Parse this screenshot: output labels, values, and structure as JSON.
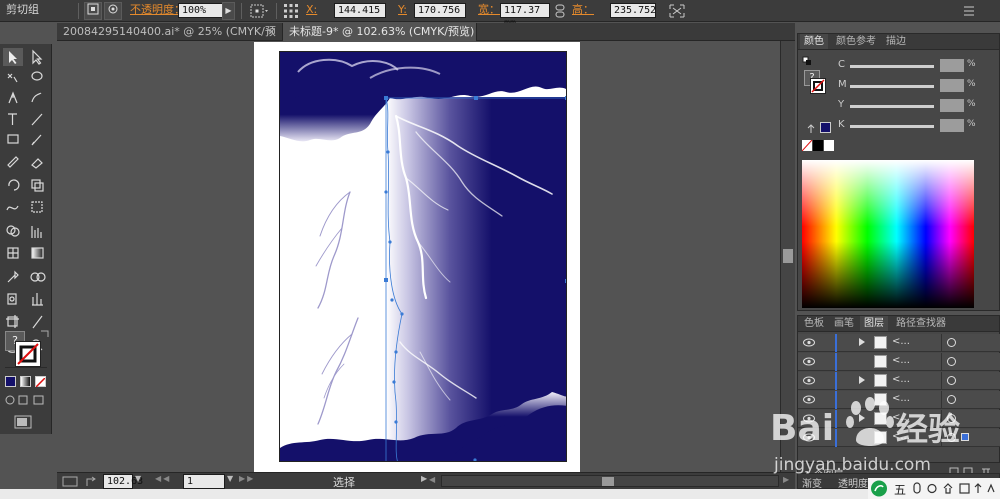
{
  "control_bar": {
    "selection_type": "剪切组",
    "opacity_label": "不透明度：",
    "opacity_value": "100%",
    "x_label": "X:",
    "x_value": "144.415",
    "y_label": "Y:",
    "y_value": "170.756",
    "w_label": "宽：",
    "w_value": "117.37 mm",
    "h_label": "高：",
    "h_value": "235.752"
  },
  "tabs": [
    {
      "label": "20084295140400.ai* @ 25% (CMYK/预览)",
      "close": "×"
    },
    {
      "label": "未标题-9* @ 102.63% (CMYK/预览)",
      "close": "×"
    }
  ],
  "color_panel": {
    "tabs": [
      "颜色",
      "颜色参考",
      "描边"
    ],
    "channels": [
      {
        "label": "C",
        "unit": "%"
      },
      {
        "label": "M",
        "unit": "%"
      },
      {
        "label": "Y",
        "unit": "%"
      },
      {
        "label": "K",
        "unit": "%"
      }
    ],
    "fill_color": "#14106a"
  },
  "layers_panel": {
    "tabs": [
      "色板",
      "画笔",
      "图层",
      "路径查找器"
    ],
    "rows": [
      {
        "name": "<...",
        "has_arrow": true
      },
      {
        "name": "<...",
        "has_arrow": false
      },
      {
        "name": "<...",
        "has_arrow": true
      },
      {
        "name": "<...",
        "has_arrow": false
      },
      {
        "name": "<...",
        "has_arrow": true
      },
      {
        "name": "<...",
        "has_arrow": false
      }
    ],
    "footer_label": "1 个图层",
    "bottom_tabs": [
      "渐变",
      "透明度"
    ]
  },
  "status_bar": {
    "zoom": "102.63",
    "artboard_number": "1",
    "tool_name": "选择"
  },
  "watermark": {
    "brand": "Bai",
    "brand_cn": "经验",
    "url": "jingyan.baidu.com"
  },
  "taskbar": {
    "ime_label": "五"
  },
  "colors": {
    "artwork_navy": "#14106a",
    "selection_blue": "#3a7bd5",
    "ui_bg": "#535353"
  }
}
